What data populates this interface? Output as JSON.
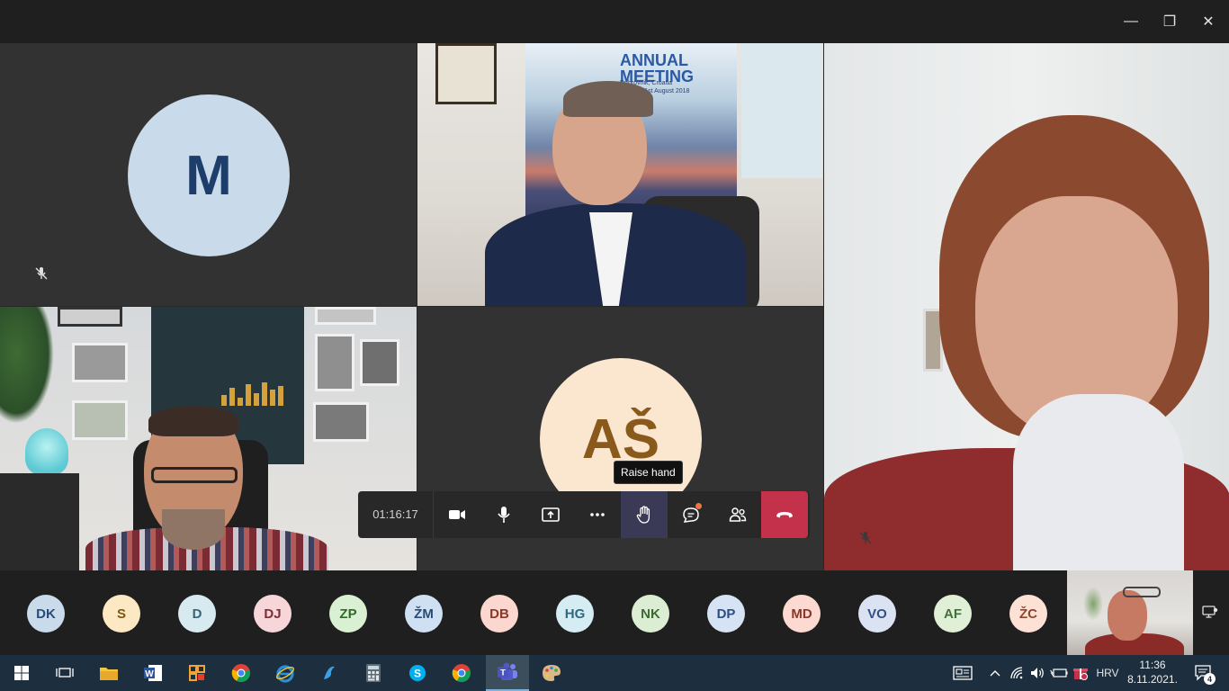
{
  "window": {
    "minimize": "—",
    "restore": "❐",
    "close": "✕"
  },
  "tiles": {
    "m": {
      "initials": "M",
      "bg": "#c9daea",
      "fg": "#1d3d6b"
    },
    "as": {
      "initials": "AŠ",
      "bg": "#fbe6d0",
      "fg": "#8a5a1c"
    },
    "poster_title": "ANNUAL\nMEETING",
    "poster_sub": "Dubrovnik, Croatia\n27th to 31st August 2018"
  },
  "controls": {
    "timer": "01:16:17",
    "tooltip": "Raise hand",
    "accent_hangup": "#c4314b"
  },
  "participants": [
    {
      "initials": "DK",
      "bg": "#c9daea",
      "fg": "#274b7a"
    },
    {
      "initials": "S",
      "bg": "#fde8c4",
      "fg": "#7d5812"
    },
    {
      "initials": "D",
      "bg": "#d7eaf0",
      "fg": "#3a6476"
    },
    {
      "initials": "DJ",
      "bg": "#f6d6d8",
      "fg": "#7a2f38"
    },
    {
      "initials": "ZP",
      "bg": "#d9f0d2",
      "fg": "#2e6a2a"
    },
    {
      "initials": "ŽM",
      "bg": "#cfe0f3",
      "fg": "#284a76"
    },
    {
      "initials": "DB",
      "bg": "#fbd7cf",
      "fg": "#8a3a28"
    },
    {
      "initials": "HG",
      "bg": "#d5ecf3",
      "fg": "#2e6880"
    },
    {
      "initials": "NK",
      "bg": "#dbeed3",
      "fg": "#3d6a32"
    },
    {
      "initials": "DP",
      "bg": "#d6e3f4",
      "fg": "#2d4f80"
    },
    {
      "initials": "MD",
      "bg": "#fcd9d1",
      "fg": "#8b3628"
    },
    {
      "initials": "VO",
      "bg": "#dbe2f2",
      "fg": "#344e86"
    },
    {
      "initials": "AF",
      "bg": "#dff0d6",
      "fg": "#43703a"
    },
    {
      "initials": "ŽC",
      "bg": "#fde1d5",
      "fg": "#8e4630"
    }
  ],
  "taskbar": {
    "lang": "HRV",
    "time": "11:36",
    "date": "8.11.2021.",
    "notif_count": "4"
  }
}
